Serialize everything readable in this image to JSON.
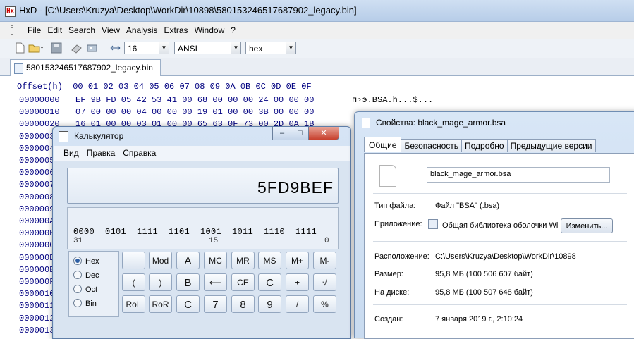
{
  "hxd": {
    "title": "HxD - [C:\\Users\\Kruzya\\Desktop\\WorkDir\\10898\\580153246517687902_legacy.bin]",
    "menu": [
      "File",
      "Edit",
      "Search",
      "View",
      "Analysis",
      "Extras",
      "Window",
      "?"
    ],
    "toolbar": {
      "bytes_per_row": "16",
      "charset": "ANSI",
      "offset_base": "hex"
    },
    "tab_label": "580153246517687902_legacy.bin",
    "hex_header": "Offset(h)  00 01 02 03 04 05 06 07 08 09 0A 0B 0C 0D 0E 0F",
    "rows": [
      {
        "offset": "00000000",
        "bytes": "EF 9B FD 05 42 53 41 00 68 00 00 00 24 00 00 00",
        "ascii": "п›э.BSA.h...$..."
      },
      {
        "offset": "00000010",
        "bytes": "07 00 00 00 04 00 00 00 19 01 00 00 3B 00 00 00",
        "ascii": ""
      },
      {
        "offset": "00000020",
        "bytes": "16 01 00 00 03 01 00 00 65 63 0F 73 00 2D 0A 1B",
        "ascii": ""
      },
      {
        "offset": "00000030",
        "bytes": "",
        "ascii": ""
      },
      {
        "offset": "00000040",
        "bytes": "",
        "ascii": ""
      },
      {
        "offset": "00000050",
        "bytes": "",
        "ascii": ""
      },
      {
        "offset": "00000060",
        "bytes": "",
        "ascii": ""
      },
      {
        "offset": "00000070",
        "bytes": "",
        "ascii": ""
      },
      {
        "offset": "00000080",
        "bytes": "",
        "ascii": ""
      },
      {
        "offset": "00000090",
        "bytes": "",
        "ascii": ""
      },
      {
        "offset": "000000A0",
        "bytes": "",
        "ascii": ""
      },
      {
        "offset": "000000B0",
        "bytes": "",
        "ascii": ""
      },
      {
        "offset": "000000C0",
        "bytes": "",
        "ascii": ""
      },
      {
        "offset": "000000D0",
        "bytes": "",
        "ascii": ""
      },
      {
        "offset": "000000E0",
        "bytes": "",
        "ascii": ""
      },
      {
        "offset": "000000F0",
        "bytes": "",
        "ascii": ""
      },
      {
        "offset": "00000100",
        "bytes": "",
        "ascii": ""
      },
      {
        "offset": "00000110",
        "bytes": "",
        "ascii": ""
      },
      {
        "offset": "00000120",
        "bytes": "",
        "ascii": ""
      },
      {
        "offset": "00000130",
        "bytes": "",
        "ascii": ""
      }
    ]
  },
  "calculator": {
    "title": "Калькулятор",
    "menu": [
      "Вид",
      "Правка",
      "Справка"
    ],
    "display": "5FD9BEF",
    "bit_groups": "0000  0101  1111  1101  1001  1011  1110  1111",
    "bit_positions": [
      "31",
      "15",
      "0"
    ],
    "radix_options": [
      {
        "label": "Hex",
        "selected": true
      },
      {
        "label": "Dec",
        "selected": false
      },
      {
        "label": "Oct",
        "selected": false
      },
      {
        "label": "Bin",
        "selected": false
      }
    ],
    "keys": [
      [
        "",
        "Mod",
        "A",
        "MC",
        "MR",
        "MS",
        "M+",
        "M-"
      ],
      [
        "(",
        ")",
        "B",
        "⟵",
        "CE",
        "C",
        "±",
        "√"
      ],
      [
        "RoL",
        "RoR",
        "C",
        "7",
        "8",
        "9",
        "/",
        "%"
      ]
    ],
    "window_buttons": {
      "minimize": "–",
      "maximize": "□",
      "close": "✕"
    }
  },
  "properties": {
    "title": "Свойства: black_mage_armor.bsa",
    "tabs": [
      "Общие",
      "Безопасность",
      "Подробно",
      "Предыдущие версии"
    ],
    "file_name": "black_mage_armor.bsa",
    "type_label": "Тип файла:",
    "type_value": "Файл \"BSA\" (.bsa)",
    "app_label": "Приложение:",
    "app_value": "Общая библиотека оболочки Wi",
    "change_button": "Изменить...",
    "location_label": "Расположение:",
    "location_value": "C:\\Users\\Kruzya\\Desktop\\WorkDir\\10898",
    "size_label": "Размер:",
    "size_value": "95,8 МБ (100 506 607 байт)",
    "disk_label": "На диске:",
    "disk_value": "95,8 МБ (100 507 648 байт)",
    "created_label": "Создан:",
    "created_value": "7 января 2019 г., 2:10:24"
  }
}
